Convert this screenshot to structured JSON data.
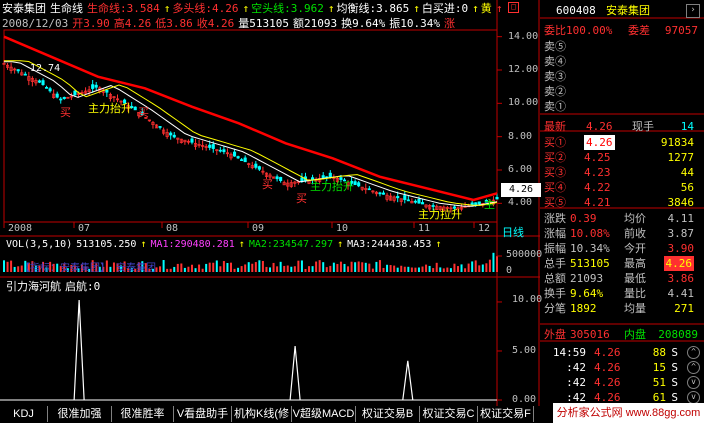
{
  "header": {
    "stock": "安泰集团",
    "indicator": "生命线",
    "items": [
      {
        "text": "生命线:3.584",
        "color": "red"
      },
      {
        "text": "多头线:4.26",
        "color": "red"
      },
      {
        "text": "空头线:3.962",
        "color": "grn"
      },
      {
        "text": "均衡线:3.865",
        "color": "wht"
      },
      {
        "text": "白买进:0",
        "color": "wht"
      },
      {
        "text": "黄",
        "color": "yel"
      }
    ],
    "arrow_after": [
      true,
      true,
      true,
      true,
      true,
      false
    ]
  },
  "ohlc_line": {
    "date": "2008/12/03",
    "items": [
      {
        "text": "开3.90",
        "color": "red"
      },
      {
        "text": "高4.26",
        "color": "red"
      },
      {
        "text": "低3.86",
        "color": "red"
      },
      {
        "text": "收4.26",
        "color": "red"
      },
      {
        "text": "量513105",
        "color": "wht"
      },
      {
        "text": "额21093",
        "color": "wht"
      },
      {
        "text": "换9.64%",
        "color": "wht"
      },
      {
        "text": "振10.34%",
        "color": "wht"
      },
      {
        "text": "涨",
        "color": "red"
      }
    ]
  },
  "y_axis": [
    "14.00",
    "12.00",
    "10.00",
    "8.00",
    "6.00",
    "4.00"
  ],
  "x_axis": [
    "2008",
    "07",
    "08",
    "09",
    "10",
    "11",
    "12"
  ],
  "period_label": "日线",
  "annotations": {
    "hi_price": "12.74",
    "buy": "买",
    "main_lift": "主力拉升",
    "main_up": "主力抬升",
    "main": "主",
    "current_price": "4.26"
  },
  "volume": {
    "title": "VOL(3,5,10)",
    "vol": "513105.250",
    "ma1": "MA1:290480.281",
    "ma2": "MA2:234547.297",
    "ma3": "MA3:244438.453",
    "axis": [
      "500000",
      "0"
    ],
    "watermark": "【指标：安泰集团】  安泰集团"
  },
  "indicator2": {
    "name": "引力海河航",
    "value": "启航:0",
    "axis": [
      "10.00",
      "5.00",
      "0.00"
    ]
  },
  "right_panel": {
    "code": "600408",
    "name": "安泰集团",
    "commit_label": "委比",
    "commit_value": "100.00%",
    "diff_label": "委差",
    "diff_value": "97057",
    "sell": [
      {
        "label": "卖⑤",
        "price": "",
        "vol": ""
      },
      {
        "label": "卖④",
        "price": "",
        "vol": ""
      },
      {
        "label": "卖③",
        "price": "",
        "vol": ""
      },
      {
        "label": "卖②",
        "price": "",
        "vol": ""
      },
      {
        "label": "卖①",
        "price": "",
        "vol": ""
      }
    ],
    "latest_label": "最新",
    "latest_value": "4.26",
    "hand_label": "现手",
    "hand_value": "14",
    "buy": [
      {
        "label": "买①",
        "price": "4.26",
        "vol": "91834"
      },
      {
        "label": "买②",
        "price": "4.25",
        "vol": "1277"
      },
      {
        "label": "买③",
        "price": "4.23",
        "vol": "44"
      },
      {
        "label": "买④",
        "price": "4.22",
        "vol": "56"
      },
      {
        "label": "买⑤",
        "price": "4.21",
        "vol": "3846"
      }
    ],
    "stats": [
      {
        "l1": "涨跌",
        "v1": "0.39",
        "c1": "red",
        "l2": "均价",
        "v2": "4.11",
        "c2": "gray"
      },
      {
        "l1": "涨幅",
        "v1": "10.08%",
        "c1": "red",
        "l2": "前收",
        "v2": "3.87",
        "c2": "gray"
      },
      {
        "l1": "振幅",
        "v1": "10.34%",
        "c1": "gray",
        "l2": "今开",
        "v2": "3.90",
        "c2": "red"
      },
      {
        "l1": "总手",
        "v1": "513105",
        "c1": "yel",
        "l2": "最高",
        "v2": "4.26",
        "c2": "hl"
      },
      {
        "l1": "总额",
        "v1": "21093",
        "c1": "gray",
        "l2": "最低",
        "v2": "3.86",
        "c2": "red"
      },
      {
        "l1": "换手",
        "v1": "9.64%",
        "c1": "yel",
        "l2": "量比",
        "v2": "4.41",
        "c2": "gray"
      },
      {
        "l1": "分笔",
        "v1": "1892",
        "c1": "yel",
        "l2": "均量",
        "v2": "271",
        "c2": "yel"
      }
    ],
    "outer_label": "外盘",
    "outer_value": "305016",
    "inner_label": "内盘",
    "inner_value": "208089",
    "ticks": [
      {
        "time": "14:59",
        "price": "4.26",
        "vol": "88",
        "side": "S"
      },
      {
        "time": ":42",
        "price": "4.26",
        "vol": "15",
        "side": "S"
      },
      {
        "time": ":42",
        "price": "4.26",
        "vol": "51",
        "side": "S"
      },
      {
        "time": ":42",
        "price": "4.26",
        "vol": "61",
        "side": "S"
      }
    ]
  },
  "tabs": [
    "KDJ",
    "很准加强",
    "很准胜率",
    "V看盘助手",
    "机构K线(修",
    "V超级MACD",
    "权证交易B",
    "权证交易C",
    "权证交易F"
  ],
  "footer_watermark": "分析家公式网 www.88gg.com",
  "chart_data": {
    "type": "candlestick",
    "x": [
      "2008",
      "07",
      "08",
      "09",
      "10",
      "11",
      "12"
    ],
    "ylim": [
      3.0,
      15.0
    ],
    "ticks": [
      14,
      12,
      10,
      8,
      6,
      4
    ],
    "lifeline_red": [
      [
        0,
        14.0
      ],
      [
        0.1,
        12.8
      ],
      [
        0.2,
        11.6
      ],
      [
        0.3,
        10.9
      ],
      [
        0.4,
        9.8
      ],
      [
        0.5,
        8.8
      ],
      [
        0.6,
        7.6
      ],
      [
        0.7,
        6.7
      ],
      [
        0.8,
        5.6
      ],
      [
        0.9,
        4.9
      ],
      [
        1.0,
        4.2
      ],
      [
        1.05,
        4.6
      ]
    ],
    "indicator_peaks": [
      {
        "pos": 0.16,
        "value": 10.2
      },
      {
        "pos": 0.62,
        "value": 5.5
      },
      {
        "pos": 0.86,
        "value": 4.0
      }
    ]
  }
}
